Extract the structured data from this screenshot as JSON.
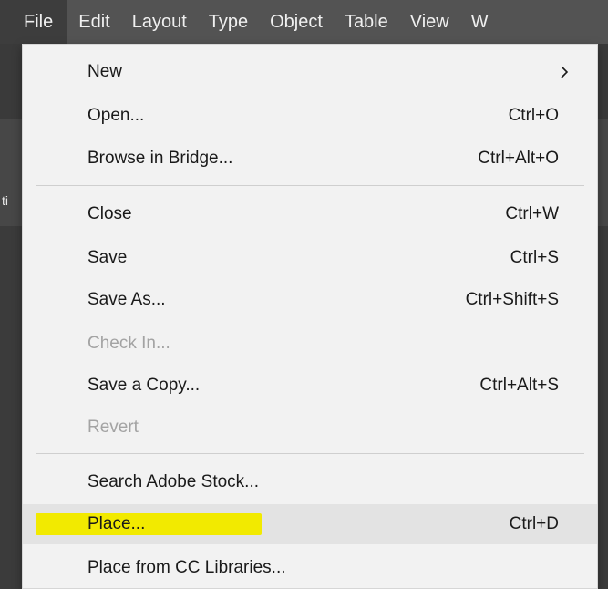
{
  "menubar": {
    "items": [
      {
        "label": "File",
        "active": true
      },
      {
        "label": "Edit"
      },
      {
        "label": "Layout"
      },
      {
        "label": "Type"
      },
      {
        "label": "Object"
      },
      {
        "label": "Table"
      },
      {
        "label": "View"
      },
      {
        "label": "W"
      }
    ]
  },
  "file_menu": {
    "items": [
      {
        "label": "New",
        "shortcut": "",
        "submenu_icon": "chevron-right-icon"
      },
      {
        "label": "Open...",
        "shortcut": "Ctrl+O"
      },
      {
        "label": "Browse in Bridge...",
        "shortcut": "Ctrl+Alt+O"
      },
      {
        "label": "Close",
        "shortcut": "Ctrl+W"
      },
      {
        "label": "Save",
        "shortcut": "Ctrl+S"
      },
      {
        "label": "Save As...",
        "shortcut": "Ctrl+Shift+S"
      },
      {
        "label": "Check In...",
        "shortcut": "",
        "disabled": true
      },
      {
        "label": "Save a Copy...",
        "shortcut": "Ctrl+Alt+S"
      },
      {
        "label": "Revert",
        "shortcut": "",
        "disabled": true
      },
      {
        "label": "Search Adobe Stock...",
        "shortcut": ""
      },
      {
        "label": "Place...",
        "shortcut": "Ctrl+D",
        "hovered": true
      },
      {
        "label": "Place from CC Libraries...",
        "shortcut": ""
      }
    ]
  },
  "background": {
    "stub_text": "ti"
  },
  "colors": {
    "menubar": "#535353",
    "menu_bg": "#f2f2f2",
    "hover_bg": "#e3e3e3",
    "highlight": "#f2ea00",
    "disabled_text": "#a3a3a3"
  }
}
